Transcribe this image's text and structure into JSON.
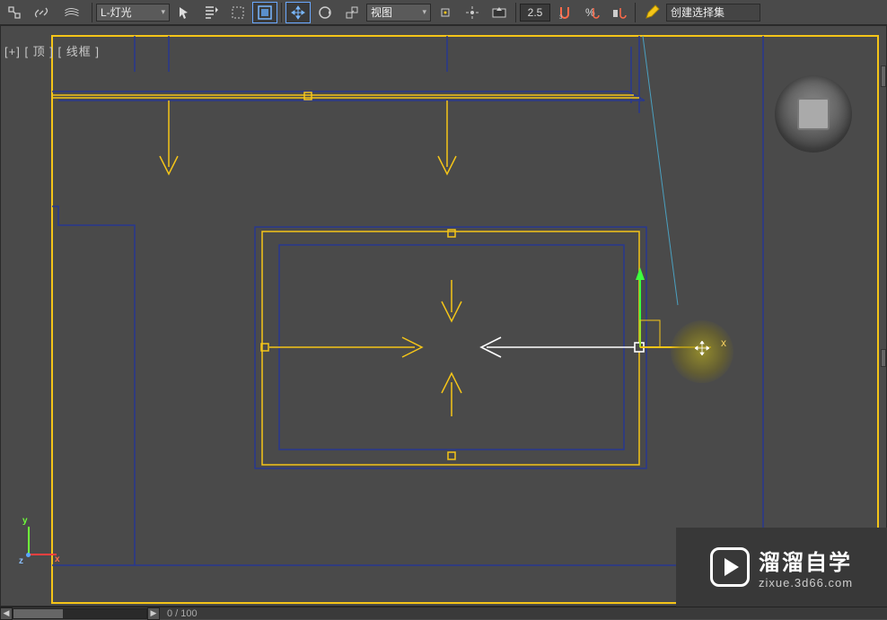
{
  "toolbar": {
    "layer_combo": "L-灯光",
    "view_combo": "视图",
    "angle_value": "2.5",
    "named_selection_placeholder": "创建选择集",
    "icons": {
      "schematic": "schematic-view-icon",
      "link": "link-icon",
      "layers": "layers-icon",
      "unlink": "unlink-icon",
      "hierarchy": "hierarchy-icon",
      "region": "region-select-icon",
      "window_crossing": "window-crossing-icon",
      "move": "move-icon",
      "rotate": "rotate-icon",
      "scale": "scale-icon",
      "ref_coord": "ref-coord-icon",
      "use_center": "use-center-icon",
      "select_manip": "select-manipulate-icon",
      "keyboard_shortcut": "keyboard-shortcut-icon",
      "snap": "snap-toggle-icon",
      "angle_snap": "angle-snap-icon",
      "percent_snap": "percent-snap-icon",
      "spinner_snap": "spinner-snap-icon",
      "edit_named": "edit-named-icon",
      "mirror": "mirror-icon"
    }
  },
  "viewport": {
    "label_parts": [
      "[+]",
      "[ 顶 ]",
      "[ 线框 ]"
    ]
  },
  "gizmo": {
    "axis_x_label": "x"
  },
  "axis_tripod": {
    "x": "x",
    "y": "y",
    "z": "z"
  },
  "watermark": {
    "title_cn": "溜溜自学",
    "subtitle_en": "zixue.3d66.com"
  },
  "timeline": {
    "frame_display": "0 / 100"
  }
}
